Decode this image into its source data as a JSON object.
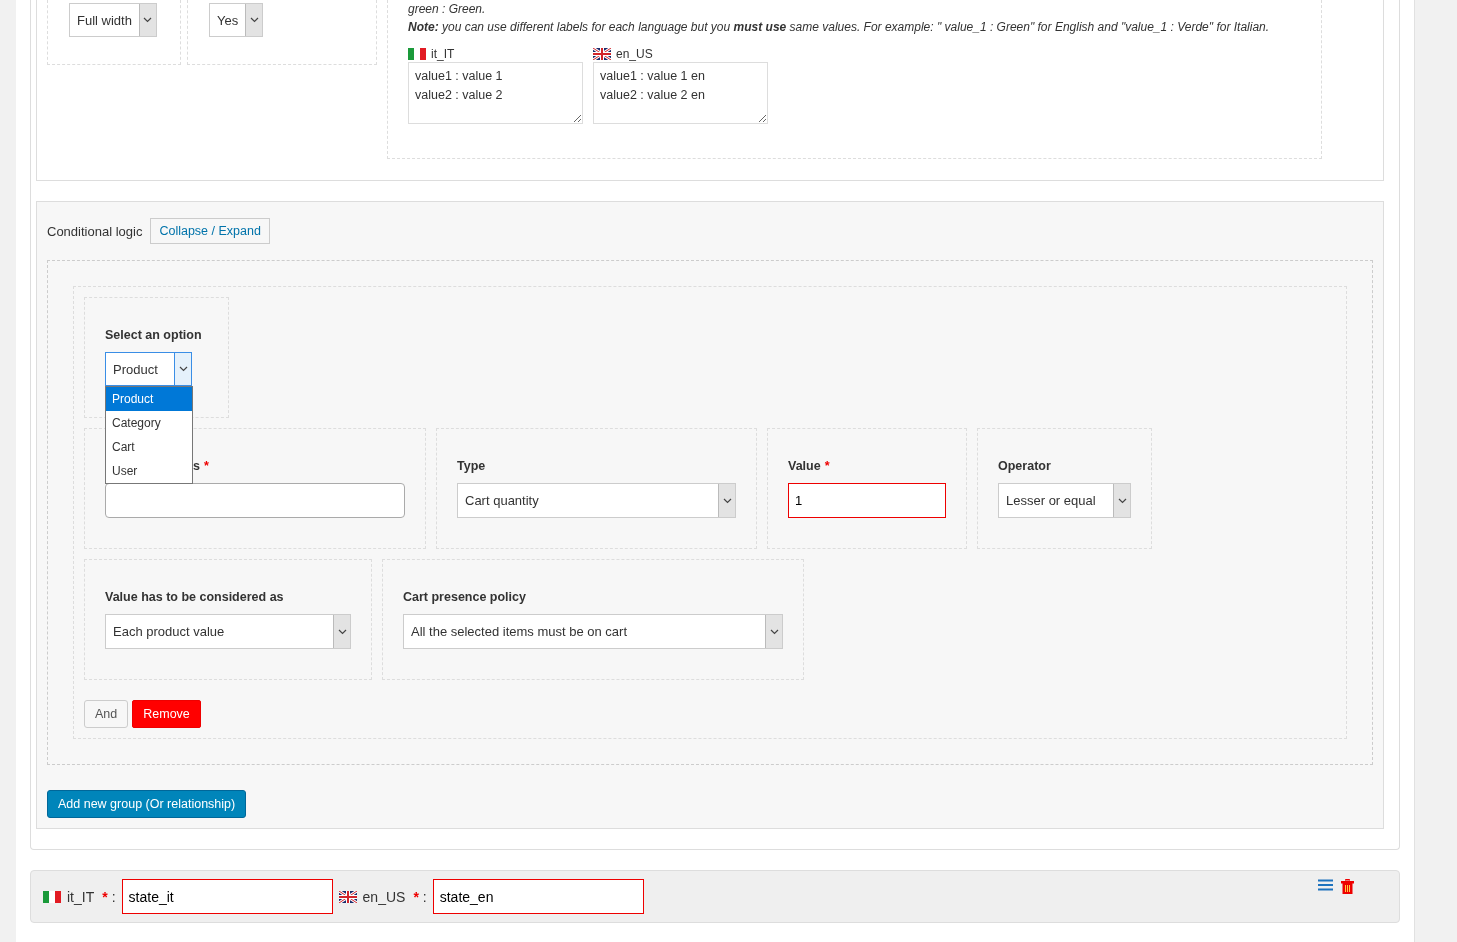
{
  "field_settings": {
    "selects": [
      {
        "value": "Full width"
      },
      {
        "value": "Yes"
      }
    ],
    "help": {
      "example": "green : Green.",
      "note": "**Note:** you can use different labels for each language but you **must use** same values. For example: \" value_1 : Green\" for English and \"value_1 : Verde\" for Italian."
    },
    "translations": [
      {
        "locale": "it_IT",
        "kind": "italian",
        "value": "value1 : value 1\nvalue2 : value 2"
      },
      {
        "locale": "en_US",
        "kind": "british",
        "value": "value1 : value 1 en\nvalue2 : value 2 en"
      }
    ]
  },
  "conditional_logic": {
    "label": "Conditional logic",
    "toggle_button": "Collapse / Expand",
    "groups": [
      {
        "option_select": {
          "label": "Select an option",
          "value": "Product",
          "expanded": true,
          "options": [
            {
              "label": "Product",
              "selected": true
            },
            {
              "label": "Category",
              "selected": false
            },
            {
              "label": "Cart",
              "selected": false
            },
            {
              "label": "User",
              "selected": false
            }
          ]
        },
        "fields": [
          {
            "kind": "text",
            "label": "s",
            "required_mark": "*",
            "invalid": false
          },
          {
            "kind": "select",
            "label": "Type",
            "value": "Cart quantity"
          },
          {
            "kind": "text",
            "label": "Value",
            "required_mark": "*",
            "value": "1",
            "invalid": true
          },
          {
            "kind": "select",
            "label": "Operator",
            "value": "Lesser or equal"
          }
        ],
        "fields_2": [
          {
            "kind": "select",
            "label": "Value has to be considered as",
            "value": "Each product value"
          },
          {
            "kind": "select",
            "label": "Cart presence policy",
            "value": "All the selected items must be on cart"
          }
        ],
        "buttons": [
          {
            "label": "And",
            "kind": "secondary"
          },
          {
            "label": "Remove",
            "kind": "danger"
          }
        ]
      }
    ],
    "add_group_button": "Add new group (Or relationship)"
  },
  "state_row": {
    "translations": [
      {
        "locale": "it_IT",
        "kind": "italian",
        "required_mark": "*",
        "separator": ":",
        "value": "state_it",
        "invalid": true
      },
      {
        "locale": "en_US",
        "kind": "british",
        "required_mark": "*",
        "separator": ":",
        "value": "state_en",
        "invalid": true
      }
    ]
  }
}
